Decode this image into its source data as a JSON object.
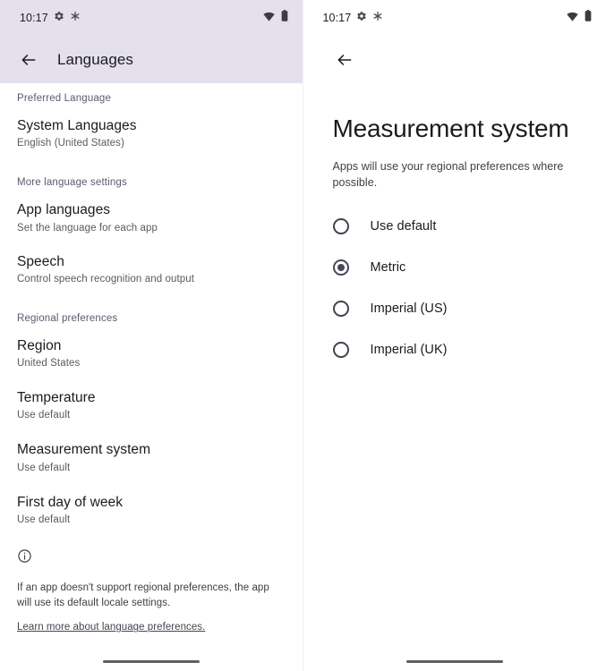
{
  "left_panel": {
    "status_bar": {
      "clock": "10:17",
      "icons": [
        "gear-icon",
        "snowflake-icon"
      ],
      "right_icons": [
        "wifi-icon",
        "battery-icon"
      ]
    },
    "app_bar": {
      "back_label": "back-arrow",
      "title": "Languages"
    },
    "sections": [
      {
        "header": "Preferred Language",
        "rows": [
          {
            "title": "System Languages",
            "subtitle": "English (United States)"
          }
        ]
      },
      {
        "header": "More language settings",
        "rows": [
          {
            "title": "App languages",
            "subtitle": "Set the language for each app"
          },
          {
            "title": "Speech",
            "subtitle": "Control speech recognition and output"
          }
        ]
      },
      {
        "header": "Regional preferences",
        "rows": [
          {
            "title": "Region",
            "subtitle": "United States"
          },
          {
            "title": "Temperature",
            "subtitle": "Use default"
          },
          {
            "title": "Measurement system",
            "subtitle": "Use default"
          },
          {
            "title": "First day of week",
            "subtitle": "Use default"
          }
        ]
      }
    ],
    "footer": {
      "icon": "info-icon",
      "text": "If an app doesn't support regional preferences, the app will use its default locale settings.",
      "link": "Learn more about language preferences."
    }
  },
  "right_panel": {
    "status_bar": {
      "clock": "10:17",
      "icons": [
        "gear-icon",
        "snowflake-icon"
      ],
      "right_icons": [
        "wifi-icon",
        "battery-icon"
      ]
    },
    "app_bar": {
      "back_label": "back-arrow"
    },
    "title": "Measurement system",
    "subtitle": "Apps will use your regional preferences where possible.",
    "options": [
      {
        "label": "Use default",
        "selected": false
      },
      {
        "label": "Metric",
        "selected": true
      },
      {
        "label": "Imperial (US)",
        "selected": false
      },
      {
        "label": "Imperial (UK)",
        "selected": false
      }
    ]
  },
  "colors": {
    "header_band": "#e4e0ec",
    "accent": "#4a4458",
    "section_header": "#5c5a6e",
    "primary_text": "#1b1b1f",
    "secondary_text": "#5a5a60"
  }
}
